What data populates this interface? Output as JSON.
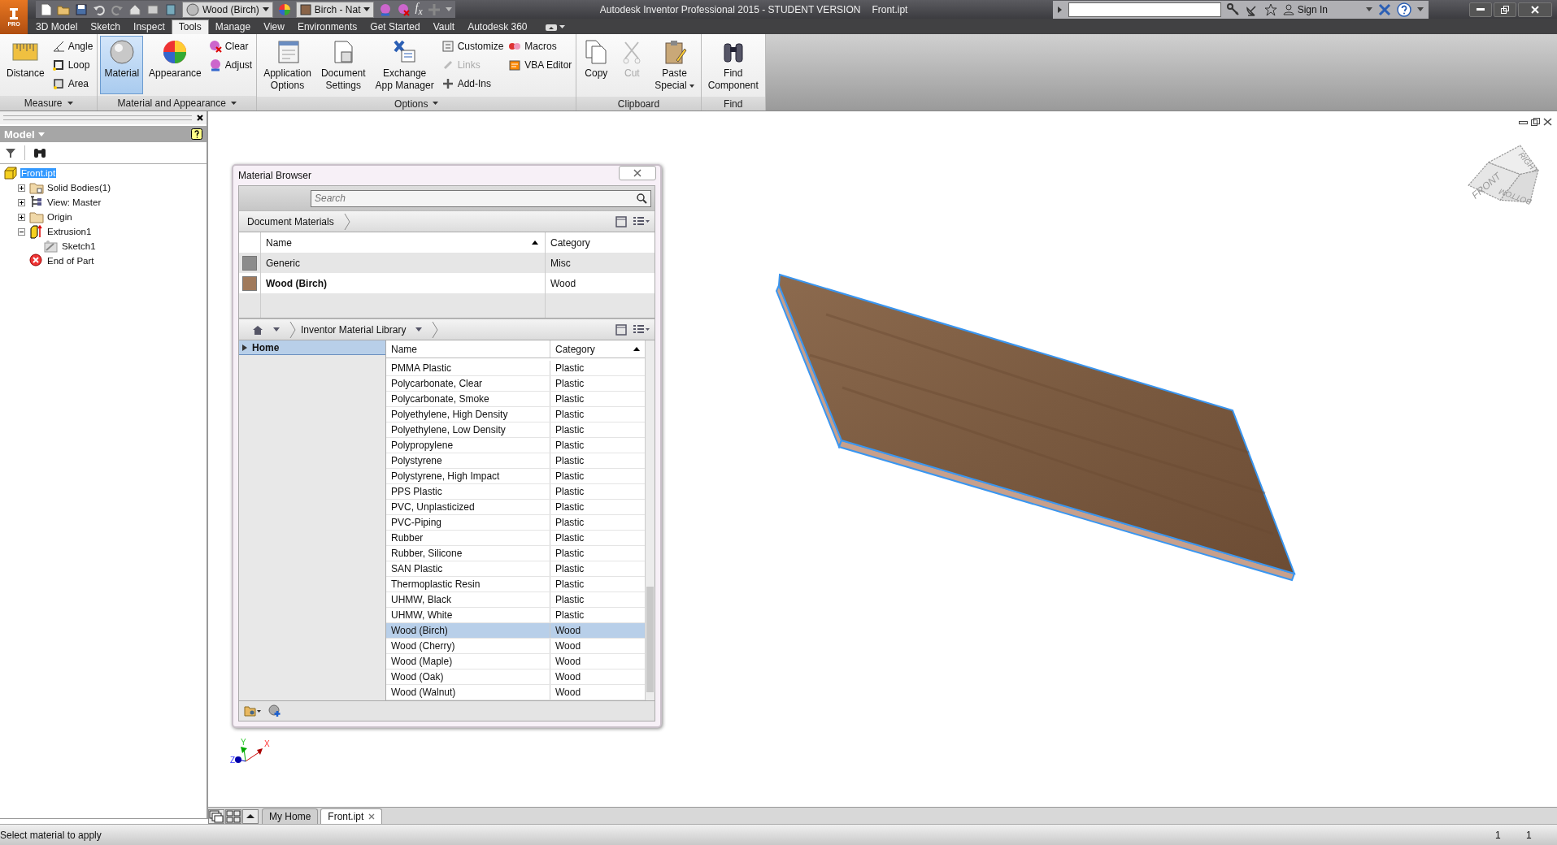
{
  "app": {
    "badge": "PRO",
    "title": "Autodesk Inventor Professional 2015 - STUDENT VERSION",
    "document": "Front.ipt",
    "sign_in": "Sign In"
  },
  "quick_access": {
    "material": "Wood (Birch)",
    "appearance": "Birch - Nat",
    "formula": "f$_{x}$"
  },
  "ribbon_tabs": [
    {
      "label": "3D Model",
      "selected": false
    },
    {
      "label": "Sketch",
      "selected": false
    },
    {
      "label": "Inspect",
      "selected": false
    },
    {
      "label": "Tools",
      "selected": true
    },
    {
      "label": "Manage",
      "selected": false
    },
    {
      "label": "View",
      "selected": false
    },
    {
      "label": "Environments",
      "selected": false
    },
    {
      "label": "Get Started",
      "selected": false
    },
    {
      "label": "Vault",
      "selected": false
    },
    {
      "label": "Autodesk 360",
      "selected": false
    }
  ],
  "ribbon_panels": [
    {
      "label": "Measure",
      "menu": true,
      "tools": [
        {
          "kind": "large",
          "lines": [
            "Distance"
          ],
          "selected": false,
          "disabled": false
        },
        {
          "kind": "small",
          "lines": [
            "Angle"
          ],
          "selected": false,
          "disabled": false
        },
        {
          "kind": "small",
          "lines": [
            "Loop"
          ],
          "selected": false,
          "disabled": false
        },
        {
          "kind": "small",
          "lines": [
            "Area"
          ],
          "selected": false,
          "disabled": false
        }
      ]
    },
    {
      "label": "Material and Appearance",
      "menu": true,
      "tools": [
        {
          "kind": "large",
          "lines": [
            "Material"
          ],
          "selected": true,
          "disabled": false
        },
        {
          "kind": "large",
          "lines": [
            "Appearance"
          ],
          "selected": false,
          "disabled": false
        },
        {
          "kind": "small",
          "lines": [
            "Clear"
          ],
          "selected": false,
          "disabled": false
        },
        {
          "kind": "small",
          "lines": [
            "Adjust"
          ],
          "selected": false,
          "disabled": false
        }
      ]
    },
    {
      "label": "Options",
      "menu": true,
      "tools": [
        {
          "kind": "large",
          "lines": [
            "Application",
            "Options"
          ],
          "selected": false,
          "disabled": false
        },
        {
          "kind": "large",
          "lines": [
            "Document",
            "Settings"
          ],
          "selected": false,
          "disabled": false
        },
        {
          "kind": "large",
          "lines": [
            "Exchange",
            "App Manager"
          ],
          "selected": false,
          "disabled": false
        },
        {
          "kind": "small",
          "lines": [
            "Customize"
          ],
          "selected": false,
          "disabled": false
        },
        {
          "kind": "small",
          "lines": [
            "Links"
          ],
          "selected": false,
          "disabled": true
        },
        {
          "kind": "small",
          "lines": [
            "Add-Ins"
          ],
          "selected": false,
          "disabled": false
        },
        {
          "kind": "small",
          "lines": [
            "Macros"
          ],
          "selected": false,
          "disabled": false
        },
        {
          "kind": "small",
          "lines": [
            "VBA Editor"
          ],
          "selected": false,
          "disabled": false
        }
      ]
    },
    {
      "label": "Clipboard",
      "menu": false,
      "tools": [
        {
          "kind": "large",
          "lines": [
            "Copy"
          ],
          "selected": false,
          "disabled": false
        },
        {
          "kind": "large",
          "lines": [
            "Cut"
          ],
          "selected": false,
          "disabled": true
        },
        {
          "kind": "large",
          "lines": [
            "Paste",
            "Special"
          ],
          "selected": false,
          "disabled": false
        }
      ]
    },
    {
      "label": "Find",
      "menu": false,
      "tools": [
        {
          "kind": "large",
          "lines": [
            "Find",
            "Component"
          ],
          "selected": false,
          "disabled": false
        }
      ]
    }
  ],
  "browser_panel": {
    "title": "Model",
    "tree": [
      {
        "kind": "part",
        "label": "Front.ipt",
        "selected": true,
        "children": [
          {
            "kind": "bodies",
            "label": "Solid Bodies(1)",
            "selected": false,
            "expanded": false
          },
          {
            "kind": "view",
            "label": "View: Master",
            "selected": false,
            "expanded": false
          },
          {
            "kind": "folder",
            "label": "Origin",
            "selected": false,
            "expanded": false
          },
          {
            "kind": "extrusion",
            "label": "Extrusion1",
            "selected": false,
            "expanded": true,
            "children": [
              {
                "kind": "sketch",
                "label": "Sketch1",
                "selected": false
              }
            ]
          },
          {
            "kind": "end",
            "label": "End of Part",
            "selected": false
          }
        ]
      }
    ]
  },
  "material_browser": {
    "title": "Material Browser",
    "search": {
      "placeholder": "Search"
    },
    "document_materials": {
      "label": "Document Materials",
      "columns": [
        "Name",
        "Category"
      ],
      "rows": [
        {
          "name": "Generic",
          "category": "Misc",
          "color": "#8c8c8c",
          "in_use": false
        },
        {
          "name": "Wood (Birch)",
          "category": "Wood",
          "color": "#a07a5c",
          "in_use": true
        }
      ]
    },
    "library": {
      "label": "Inventor Material Library",
      "tree": [
        {
          "label": "Home",
          "selected": true
        }
      ],
      "columns": [
        "Name",
        "Category"
      ],
      "rows": [
        {
          "name": "PMMA Plastic",
          "category": "Plastic",
          "selected": false
        },
        {
          "name": "Polycarbonate, Clear",
          "category": "Plastic",
          "selected": false
        },
        {
          "name": "Polycarbonate, Smoke",
          "category": "Plastic",
          "selected": false
        },
        {
          "name": "Polyethylene, High Density",
          "category": "Plastic",
          "selected": false
        },
        {
          "name": "Polyethylene, Low Density",
          "category": "Plastic",
          "selected": false
        },
        {
          "name": "Polypropylene",
          "category": "Plastic",
          "selected": false
        },
        {
          "name": "Polystyrene",
          "category": "Plastic",
          "selected": false
        },
        {
          "name": "Polystyrene, High Impact",
          "category": "Plastic",
          "selected": false
        },
        {
          "name": "PPS Plastic",
          "category": "Plastic",
          "selected": false
        },
        {
          "name": "PVC, Unplasticized",
          "category": "Plastic",
          "selected": false
        },
        {
          "name": "PVC-Piping",
          "category": "Plastic",
          "selected": false
        },
        {
          "name": "Rubber",
          "category": "Plastic",
          "selected": false
        },
        {
          "name": "Rubber, Silicone",
          "category": "Plastic",
          "selected": false
        },
        {
          "name": "SAN Plastic",
          "category": "Plastic",
          "selected": false
        },
        {
          "name": "Thermoplastic Resin",
          "category": "Plastic",
          "selected": false
        },
        {
          "name": "UHMW, Black",
          "category": "Plastic",
          "selected": false
        },
        {
          "name": "UHMW, White",
          "category": "Plastic",
          "selected": false
        },
        {
          "name": "Wood (Birch)",
          "category": "Wood",
          "selected": true
        },
        {
          "name": "Wood (Cherry)",
          "category": "Wood",
          "selected": false
        },
        {
          "name": "Wood (Maple)",
          "category": "Wood",
          "selected": false
        },
        {
          "name": "Wood (Oak)",
          "category": "Wood",
          "selected": false
        },
        {
          "name": "Wood (Walnut)",
          "category": "Wood",
          "selected": false
        }
      ]
    }
  },
  "viewcube": {
    "faces": [
      "FRONT",
      "RIGHT",
      "BOTTOM"
    ]
  },
  "triad": {
    "axes": [
      "X",
      "Y",
      "Z"
    ]
  },
  "document_tabs": [
    {
      "label": "My Home",
      "selected": false
    },
    {
      "label": "Front.ipt",
      "selected": true
    }
  ],
  "status_bar": {
    "message": "Select material to apply",
    "values": [
      "1",
      "1"
    ]
  }
}
